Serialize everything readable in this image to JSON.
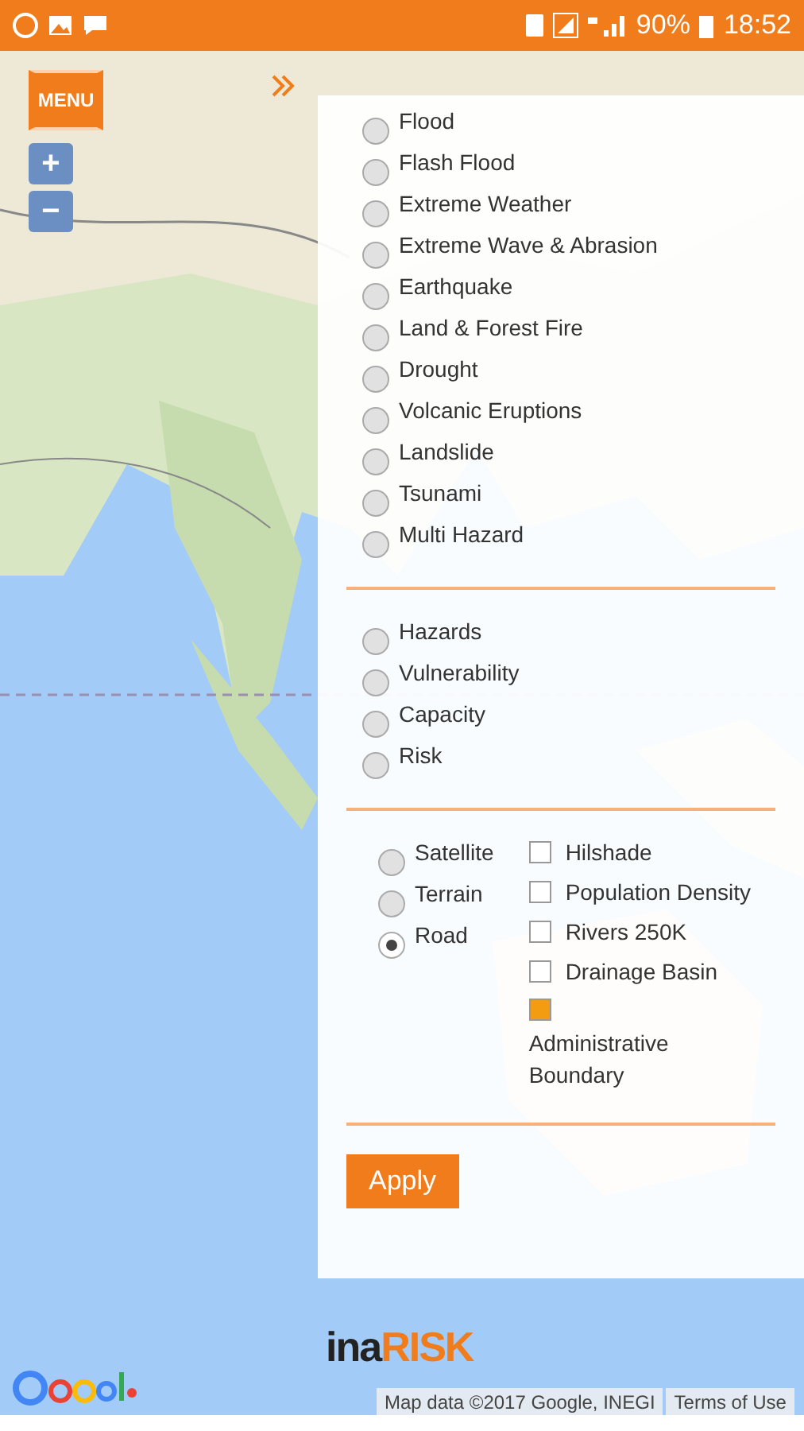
{
  "status_bar": {
    "battery": "90%",
    "time": "18:52"
  },
  "menu_button": {
    "label": "MENU"
  },
  "zoom": {
    "in": "+",
    "out": "−"
  },
  "hazards": [
    {
      "label": "Flood",
      "selected": false
    },
    {
      "label": "Flash Flood",
      "selected": false
    },
    {
      "label": "Extreme Weather",
      "selected": false
    },
    {
      "label": "Extreme Wave & Abrasion",
      "selected": false
    },
    {
      "label": "Earthquake",
      "selected": false
    },
    {
      "label": "Land & Forest Fire",
      "selected": false
    },
    {
      "label": "Drought",
      "selected": false
    },
    {
      "label": "Volcanic Eruptions",
      "selected": false
    },
    {
      "label": "Landslide",
      "selected": false
    },
    {
      "label": "Tsunami",
      "selected": false
    },
    {
      "label": "Multi Hazard",
      "selected": false
    }
  ],
  "layers": [
    {
      "label": "Hazards",
      "selected": false
    },
    {
      "label": "Vulnerability",
      "selected": false
    },
    {
      "label": "Capacity",
      "selected": false
    },
    {
      "label": "Risk",
      "selected": false
    }
  ],
  "basemaps": [
    {
      "label": "Satellite",
      "selected": false
    },
    {
      "label": "Terrain",
      "selected": false
    },
    {
      "label": "Road",
      "selected": true
    }
  ],
  "overlays": [
    {
      "label": "Hilshade",
      "checked": false
    },
    {
      "label": "Population Density",
      "checked": false
    },
    {
      "label": "Rivers 250K",
      "checked": false
    },
    {
      "label": "Drainage Basin",
      "checked": false
    },
    {
      "label": "Administrative Boundary",
      "checked": true
    }
  ],
  "apply_button": "Apply",
  "logo": {
    "dark": "ina",
    "accent": "RISK"
  },
  "attribution": [
    "Map data ©2017 Google, INEGI",
    "Terms of Use"
  ]
}
